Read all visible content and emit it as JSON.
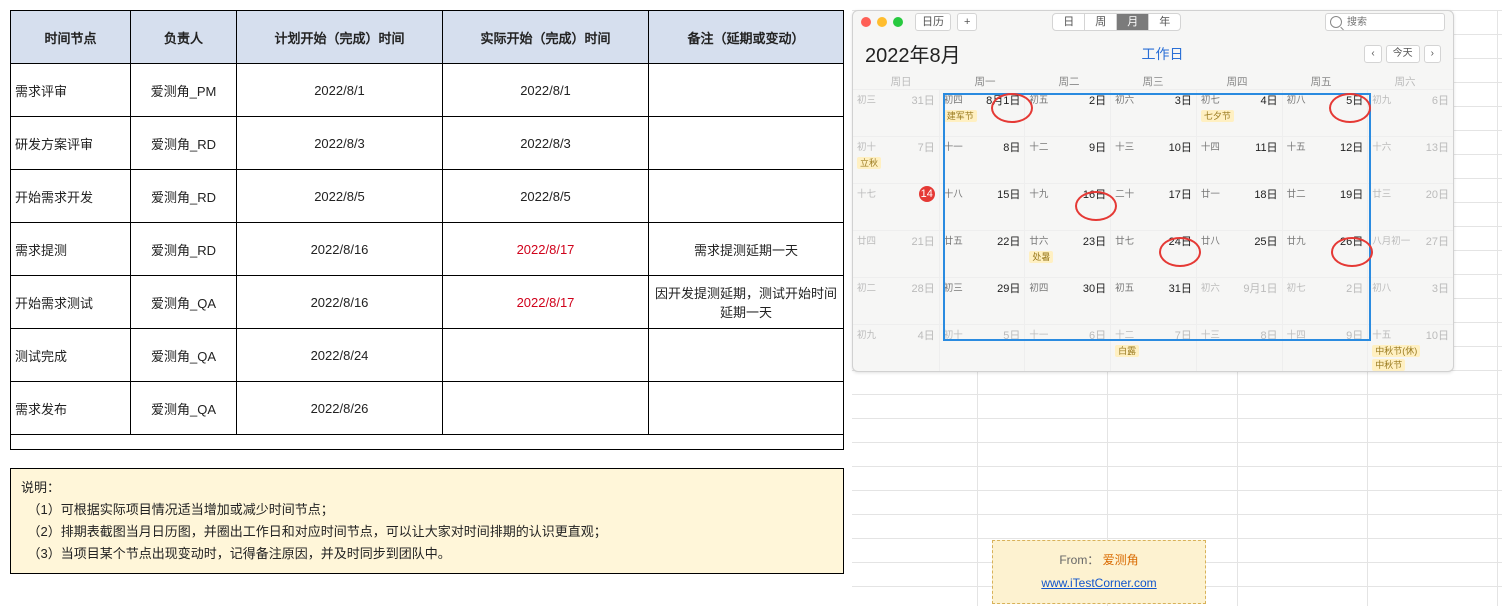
{
  "table": {
    "headers": [
      "时间节点",
      "负责人",
      "计划开始（完成）时间",
      "实际开始（完成）时间",
      "备注（延期或变动）"
    ],
    "rows": [
      {
        "milestone": "需求评审",
        "owner": "爱测角_PM",
        "plan": "2022/8/1",
        "actual": "2022/8/1",
        "note": ""
      },
      {
        "milestone": "研发方案评审",
        "owner": "爱测角_RD",
        "plan": "2022/8/3",
        "actual": "2022/8/3",
        "note": ""
      },
      {
        "milestone": "开始需求开发",
        "owner": "爱测角_RD",
        "plan": "2022/8/5",
        "actual": "2022/8/5",
        "note": ""
      },
      {
        "milestone": "需求提测",
        "owner": "爱测角_RD",
        "plan": "2022/8/16",
        "actual": "2022/8/17",
        "actual_red": true,
        "note": "需求提测延期一天"
      },
      {
        "milestone": "开始需求测试",
        "owner": "爱测角_QA",
        "plan": "2022/8/16",
        "actual": "2022/8/17",
        "actual_red": true,
        "note": "因开发提测延期，测试开始时间延期一天"
      },
      {
        "milestone": "测试完成",
        "owner": "爱测角_QA",
        "plan": "2022/8/24",
        "actual": "",
        "note": ""
      },
      {
        "milestone": "需求发布",
        "owner": "爱测角_QA",
        "plan": "2022/8/26",
        "actual": "",
        "note": ""
      }
    ]
  },
  "notes": {
    "title": "说明：",
    "lines": [
      "（1）可根据实际项目情况适当增加或减少时间节点；",
      "（2）排期表截图当月日历图，并圈出工作日和对应时间节点，可以让大家对时间排期的认识更直观；",
      "（3）当项目某个节点出现变动时，记得备注原因，并及时同步到团队中。"
    ]
  },
  "calendar": {
    "toolbar_label": "日历",
    "add_label": "+",
    "views": {
      "day": "日",
      "week": "周",
      "month": "月",
      "year": "年",
      "active": "月"
    },
    "search_placeholder": "搜索",
    "year_month": "2022年8月",
    "weekday_label": "工作日",
    "nav": {
      "prev": "‹",
      "today": "今天",
      "next": "›"
    },
    "dow": [
      "周日",
      "周一",
      "周二",
      "周三",
      "周四",
      "周五",
      "周六"
    ],
    "today_daynum": "14",
    "circled_dates": [
      "8月1日",
      "5日",
      "16日",
      "24日",
      "26日"
    ],
    "weeks": [
      [
        {
          "lunar": "初三",
          "dn": "31日",
          "dim": true
        },
        {
          "lunar": "初四",
          "dn": "8月1日",
          "ev": "建军节"
        },
        {
          "lunar": "初五",
          "dn": "2日"
        },
        {
          "lunar": "初六",
          "dn": "3日"
        },
        {
          "lunar": "初七",
          "dn": "4日",
          "ev": "七夕节"
        },
        {
          "lunar": "初八",
          "dn": "5日"
        },
        {
          "lunar": "初九",
          "dn": "6日",
          "dim": true
        }
      ],
      [
        {
          "lunar": "初十",
          "dn": "7日",
          "dim": true,
          "ev": "立秋"
        },
        {
          "lunar": "十一",
          "dn": "8日"
        },
        {
          "lunar": "十二",
          "dn": "9日"
        },
        {
          "lunar": "十三",
          "dn": "10日"
        },
        {
          "lunar": "十四",
          "dn": "11日"
        },
        {
          "lunar": "十五",
          "dn": "12日"
        },
        {
          "lunar": "十六",
          "dn": "13日",
          "dim": true
        }
      ],
      [
        {
          "lunar": "十七",
          "dn": "14",
          "dim": true,
          "today": true
        },
        {
          "lunar": "十八",
          "dn": "15日"
        },
        {
          "lunar": "十九",
          "dn": "16日"
        },
        {
          "lunar": "二十",
          "dn": "17日"
        },
        {
          "lunar": "廿一",
          "dn": "18日"
        },
        {
          "lunar": "廿二",
          "dn": "19日"
        },
        {
          "lunar": "廿三",
          "dn": "20日",
          "dim": true
        }
      ],
      [
        {
          "lunar": "廿四",
          "dn": "21日",
          "dim": true
        },
        {
          "lunar": "廿五",
          "dn": "22日"
        },
        {
          "lunar": "廿六",
          "dn": "23日",
          "ev": "处暑"
        },
        {
          "lunar": "廿七",
          "dn": "24日"
        },
        {
          "lunar": "廿八",
          "dn": "25日"
        },
        {
          "lunar": "廿九",
          "dn": "26日"
        },
        {
          "lunar": "八月初一",
          "dn": "27日",
          "dim": true
        }
      ],
      [
        {
          "lunar": "初二",
          "dn": "28日",
          "dim": true
        },
        {
          "lunar": "初三",
          "dn": "29日"
        },
        {
          "lunar": "初四",
          "dn": "30日"
        },
        {
          "lunar": "初五",
          "dn": "31日"
        },
        {
          "lunar": "初六",
          "dn": "9月1日",
          "dim": true
        },
        {
          "lunar": "初七",
          "dn": "2日",
          "dim": true
        },
        {
          "lunar": "初八",
          "dn": "3日",
          "dim": true
        }
      ],
      [
        {
          "lunar": "初九",
          "dn": "4日",
          "dim": true
        },
        {
          "lunar": "初十",
          "dn": "5日",
          "dim": true
        },
        {
          "lunar": "十一",
          "dn": "6日",
          "dim": true
        },
        {
          "lunar": "十二",
          "dn": "7日",
          "dim": true,
          "ev": "白露"
        },
        {
          "lunar": "十三",
          "dn": "8日",
          "dim": true
        },
        {
          "lunar": "十四",
          "dn": "9日",
          "dim": true
        },
        {
          "lunar": "十五",
          "dn": "10日",
          "dim": true,
          "ev": "中秋节(休)",
          "ev2": "中秋节"
        }
      ]
    ]
  },
  "attribution": {
    "from_label": "From：",
    "from_name": "爱测角",
    "url": "www.iTestCorner.com"
  }
}
